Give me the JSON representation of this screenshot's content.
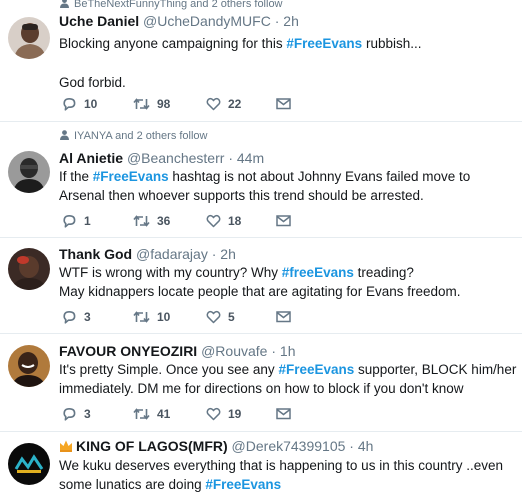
{
  "tweets": [
    {
      "context": "BeTheNextFunnyThing and 2 others follow",
      "name": "Uche Daniel",
      "handle": "@UcheDandyMUFC",
      "time": "2h",
      "text1_pre": "Blocking anyone campaigning for this ",
      "text1_tag": "#FreeEvans",
      "text1_post": " rubbish...",
      "text2": "God forbid.",
      "replies": "10",
      "retweets": "98",
      "likes": "22"
    },
    {
      "context": "IYANYA and 2 others follow",
      "name": "Al Anietie",
      "handle": "@Beanchesterr",
      "time": "44m",
      "text1_pre": "If the ",
      "text1_tag": "#FreeEvans",
      "text1_post": " hashtag is not about Johnny Evans failed move to",
      "text2": "Arsenal then whoever supports this trend should be arrested.",
      "replies": "1",
      "retweets": "36",
      "likes": "18"
    },
    {
      "name": "Thank God",
      "handle": "@fadarajay",
      "time": "2h",
      "text1_pre": "WTF is wrong with my country? Why ",
      "text1_tag": "#freeEvans",
      "text1_post": " treading?",
      "text2": "May kidnappers locate people that are agitating for Evans freedom.",
      "replies": "3",
      "retweets": "10",
      "likes": "5"
    },
    {
      "name": "FAVOUR ONYEOZIRI",
      "handle": "@Rouvafe",
      "time": "1h",
      "text1_pre": "It's pretty Simple. Once you see any ",
      "text1_tag": "#FreeEvans",
      "text1_post": " supporter, BLOCK him/her",
      "text2": "immediately. DM me for directions on how to block if you don't know",
      "replies": "3",
      "retweets": "41",
      "likes": "19"
    },
    {
      "name": "KING OF LAGOS(MFR)",
      "handle": "@Derek74399105",
      "time": "4h",
      "text1": "We kuku deserves everything that is happening to us in this country ..even",
      "text2_pre": "some lunatics are doing ",
      "text2_tag": "#FreeEvans"
    }
  ],
  "separator": "·",
  "colors": {
    "hashtag": "#1b95e0",
    "secondary": "#657786",
    "divider": "#e6ecf0"
  },
  "icons": [
    "person-icon",
    "reply-icon",
    "retweet-icon",
    "like-icon",
    "message-icon",
    "crown-icon"
  ]
}
